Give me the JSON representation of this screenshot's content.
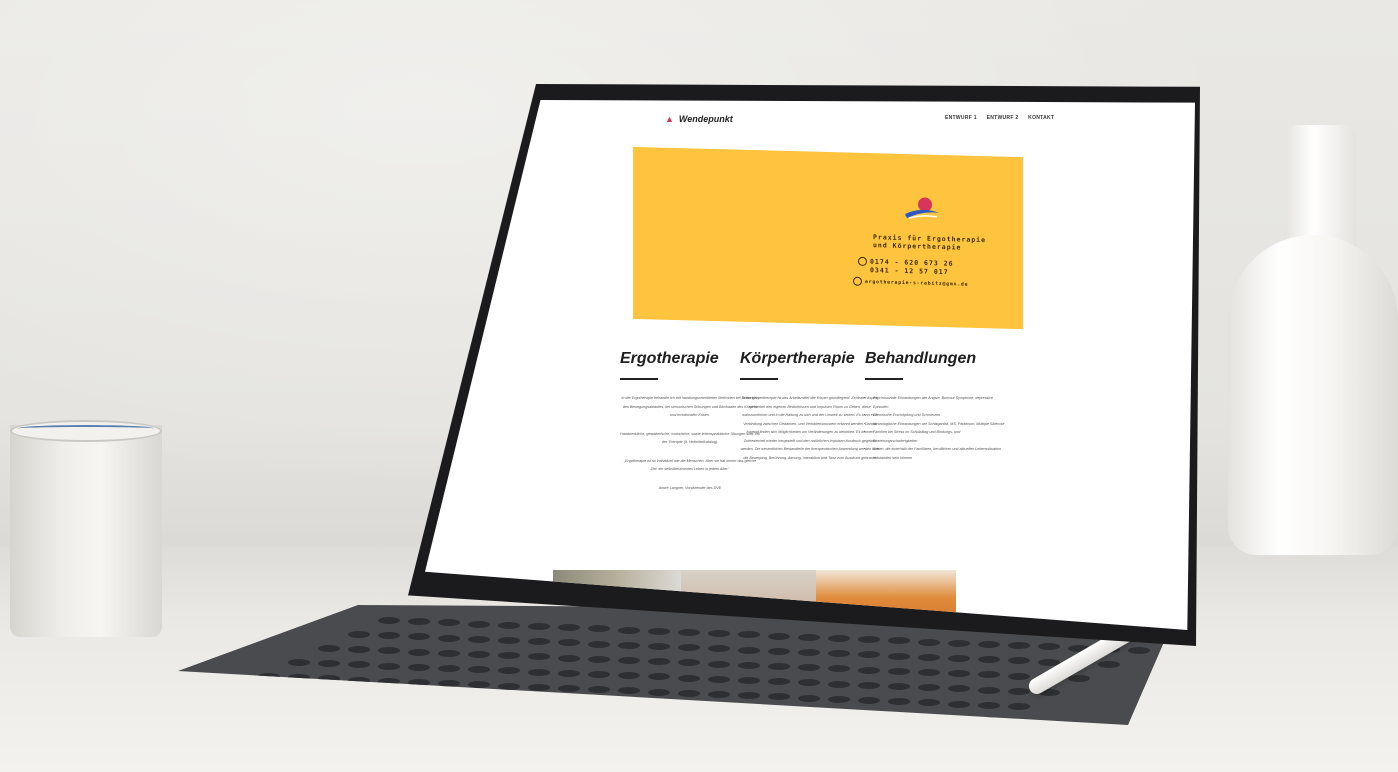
{
  "site": {
    "logo_text": "Wendepunkt",
    "nav": [
      "ENTWURF 1",
      "ENTWURF 2",
      "KONTAKT"
    ]
  },
  "hero": {
    "line1": "Praxis für Ergotherapie",
    "line2": "und Körpertherapie",
    "phone1": "0174 - 620 673 26",
    "phone2": "0341 - 12 57 017",
    "email": "ergotherapie-s-rabitz@gmx.de",
    "colors": {
      "background": "#ffc43e",
      "logo_pink": "#d9345a",
      "logo_blue": "#2b58c4"
    }
  },
  "columns": [
    {
      "title": "Ergotherapie",
      "paragraphs": [
        "In der Ergotherapie behandle ich mit handlungsorientierten Methoden bei Störungen des Bewegungsablaufes, bei sensorischen Störungen und Blockaden des Körpers und emotionalen Krisen.",
        "Handwerkliche, gestalterische, motorische, sowie lebenspraktische Übungen sind Teil der Therapie (lt. Heilmittelkatalog).",
        "„Ergotherapie ist so individuell wie die Menschen. Aber sie hat immer das gleiche Ziel: ein selbstbestimmtes Leben in jedem Alter.“",
        "André Langner, Vorsitzender des DVE"
      ]
    },
    {
      "title": "Körpertherapie",
      "paragraphs": [
        "In der Körpertherapie ist das Arbeitsmittel der Körper grundlegend. Zentraler Aspekt ist hierbei den eigenen Bedürfnissen und Impulsen Raum zu Geben, diese wahrzunehmen und in die Haltung zu sich und der Umwelt zu setzen. Es kann eine Verbindung zwischen Gedanken- und Verhaltensmustern erkannt werden. Daraus folgend finden sich Möglichkeiten um Veränderungen zu bewirken. Es können Zufriedenheit wieder hergestellt und den natürlichen Impulsen Ausdruck gegeben werden. Die wesentlichen Bestandteile der therapeutischen Anwendung werden über die Bewegung, Berührung, Atmung, Interaktion und Tanz zum Ausdruck gebracht."
      ]
    },
    {
      "title": "Behandlungen",
      "items": [
        "Psychosoziale Erkrankungen wie Ängste, Burnout Symptome, depressive Episoden",
        "Chronische Erschöpfung und Schmerzen",
        "Neurologische Erkrankungen wie Schlaganfall, MS, Parkinson, Multiple Sklerose",
        "Familien bei Stress im Schulalltag und Bindungs- und Beziehungsschwierigkeiten",
        "Krisen, die innerhalb der Familiären, beruflichen und aktuellen Lebenssituation entstanden sein können"
      ]
    }
  ]
}
